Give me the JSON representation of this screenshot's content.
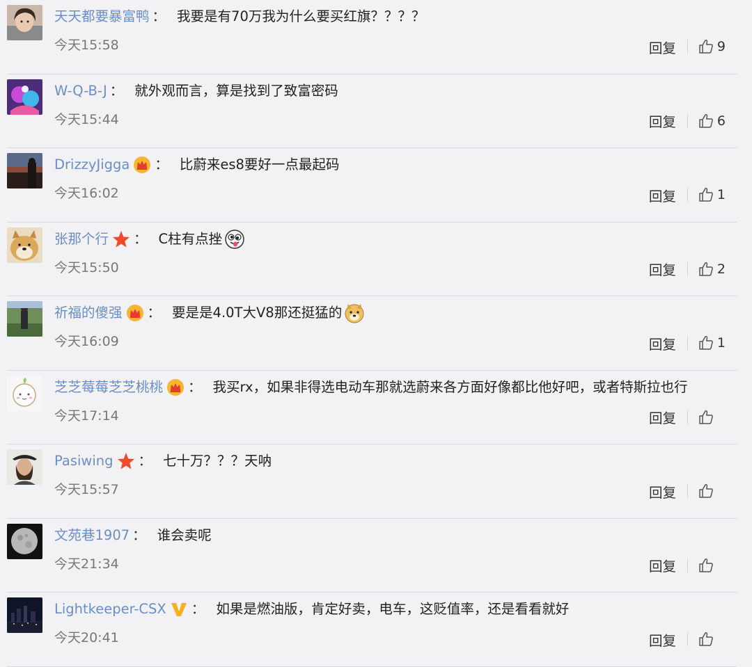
{
  "comments": [
    {
      "username": "天天都要暴富鸭",
      "badge": "",
      "text": "我要是有70万我为什么要买红旗？？？？",
      "emoji": "",
      "time": "今天15:58",
      "reply": "回复",
      "likes": "9"
    },
    {
      "username": "W-Q-B-J",
      "badge": "",
      "text": "就外观而言，算是找到了致富密码",
      "emoji": "",
      "time": "今天15:44",
      "reply": "回复",
      "likes": "6"
    },
    {
      "username": "DrizzyJigga",
      "badge": "crown-icon",
      "text": "比蔚来es8要好一点最起码",
      "emoji": "",
      "time": "今天16:02",
      "reply": "回复",
      "likes": "1"
    },
    {
      "username": "张那个行",
      "badge": "star-icon",
      "text": "C柱有点挫",
      "emoji": "silly-face-emoji",
      "time": "今天15:50",
      "reply": "回复",
      "likes": "2"
    },
    {
      "username": "祈福的傻强",
      "badge": "crown-icon",
      "text": "要是是4.0T大V8那还挺猛的",
      "emoji": "doge-emoji",
      "time": "今天16:09",
      "reply": "回复",
      "likes": "1"
    },
    {
      "username": "芝芝莓莓芝芝桃桃",
      "badge": "crown-icon",
      "text": "我买rx，如果非得选电动车那就选蔚来各方面好像都比他好吧，或者特斯拉也行",
      "emoji": "",
      "time": "今天17:14",
      "reply": "回复",
      "likes": ""
    },
    {
      "username": "Pasiwing",
      "badge": "star-icon",
      "text": "七十万？？？天呐",
      "emoji": "",
      "time": "今天15:57",
      "reply": "回复",
      "likes": ""
    },
    {
      "username": "文苑巷1907",
      "badge": "",
      "text": "谁会卖呢",
      "emoji": "",
      "time": "今天21:34",
      "reply": "回复",
      "likes": ""
    },
    {
      "username": "Lightkeeper-CSX",
      "badge": "verified-v-icon",
      "text": "如果是燃油版，肯定好卖，电车，这贬值率，还是看看就好",
      "emoji": "",
      "time": "今天20:41",
      "reply": "回复",
      "likes": ""
    }
  ],
  "separator": "：",
  "colors": {
    "username": "#6b8ec4",
    "background": "#f2f2f5",
    "time": "#777777",
    "divider": "#d9d9dd"
  }
}
